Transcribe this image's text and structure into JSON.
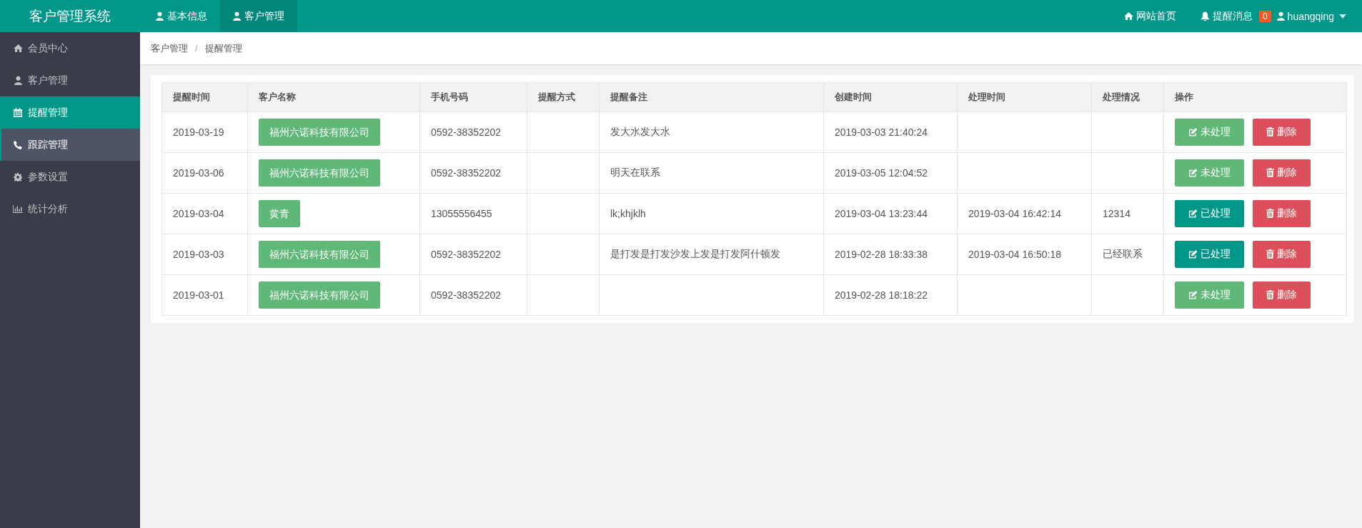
{
  "app_title": "客户管理系统",
  "top_nav": [
    {
      "label": "基本信息",
      "kind": "user",
      "selected": false
    },
    {
      "label": "客户管理",
      "kind": "user",
      "selected": true
    }
  ],
  "top_right": {
    "home_link": "网站首页",
    "notifications": {
      "label": "提醒消息",
      "count": "0"
    },
    "user": "huangqing"
  },
  "sidebar": {
    "items": [
      {
        "label": "会员中心",
        "kind": "home",
        "selected": false,
        "highlighted": false
      },
      {
        "label": "客户管理",
        "kind": "user",
        "selected": false,
        "highlighted": false
      },
      {
        "label": "提醒管理",
        "kind": "calendar",
        "selected": true,
        "highlighted": false
      },
      {
        "label": "跟踪管理",
        "kind": "phone",
        "selected": false,
        "highlighted": true
      },
      {
        "label": "参数设置",
        "kind": "gear",
        "selected": false,
        "highlighted": false
      },
      {
        "label": "统计分析",
        "kind": "chart",
        "selected": false,
        "highlighted": false
      }
    ]
  },
  "breadcrumb": [
    "客户管理",
    "/",
    "提醒管理"
  ],
  "table": {
    "columns": [
      "提醒时间",
      "客户名称",
      "手机号码",
      "提醒方式",
      "提醒备注",
      "创建时间",
      "处理时间",
      "处理情况",
      "操作"
    ],
    "rows": [
      {
        "remind_date": "2019-03-19",
        "customer": "福州六诺科技有限公司",
        "phone": "0592-38352202",
        "method": "",
        "note": "发大水发大水",
        "created": "2019-03-03 21:40:24",
        "processed_at": "",
        "result": "",
        "processed": false,
        "status_button": "未处理",
        "delete_button": "删除"
      },
      {
        "remind_date": "2019-03-06",
        "customer": "福州六诺科技有限公司",
        "phone": "0592-38352202",
        "method": "",
        "note": "明天在联系",
        "created": "2019-03-05 12:04:52",
        "processed_at": "",
        "result": "",
        "processed": false,
        "status_button": "未处理",
        "delete_button": "删除"
      },
      {
        "remind_date": "2019-03-04",
        "customer": "黄青",
        "phone": "13055556455",
        "method": "",
        "note": "lk;khjklh",
        "created": "2019-03-04 13:23:44",
        "processed_at": "2019-03-04 16:42:14",
        "result": "12314",
        "processed": true,
        "status_button": "已处理",
        "delete_button": "删除"
      },
      {
        "remind_date": "2019-03-03",
        "customer": "福州六诺科技有限公司",
        "phone": "0592-38352202",
        "method": "",
        "note": "是打发是打发沙发上发是打发阿什顿发",
        "created": "2019-02-28 18:33:38",
        "processed_at": "2019-03-04 16:50:18",
        "result": "已经联系",
        "processed": true,
        "status_button": "已处理",
        "delete_button": "删除"
      },
      {
        "remind_date": "2019-03-01",
        "customer": "福州六诺科技有限公司",
        "phone": "0592-38352202",
        "method": "",
        "note": "",
        "created": "2019-02-28 18:18:22",
        "processed_at": "",
        "result": "",
        "processed": false,
        "status_button": "未处理",
        "delete_button": "删除"
      }
    ]
  }
}
